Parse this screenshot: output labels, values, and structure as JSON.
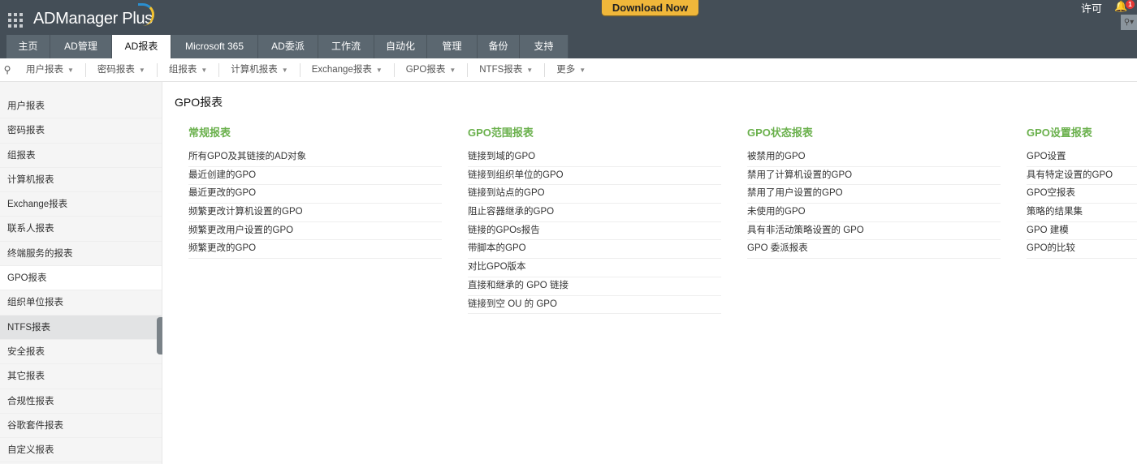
{
  "header": {
    "app_name": "ADManager Plus",
    "download_label": "Download Now",
    "license_label": "许可",
    "notification_count": "1",
    "search_icon": "search-dropdown-icon"
  },
  "tabs": [
    {
      "label": "主页"
    },
    {
      "label": "AD管理"
    },
    {
      "label": "AD报表",
      "active": true
    },
    {
      "label": "Microsoft 365"
    },
    {
      "label": "AD委派"
    },
    {
      "label": "工作流"
    },
    {
      "label": "自动化"
    },
    {
      "label": "管理"
    },
    {
      "label": "备份"
    },
    {
      "label": "支持"
    }
  ],
  "subnav": [
    "用户报表",
    "密码报表",
    "组报表",
    "计算机报表",
    "Exchange报表",
    "GPO报表",
    "NTFS报表",
    "更多"
  ],
  "sidebar": [
    "用户报表",
    "密码报表",
    "组报表",
    "计算机报表",
    "Exchange报表",
    "联系人报表",
    "终端服务的报表",
    "GPO报表",
    "组织单位报表",
    "NTFS报表",
    "安全报表",
    "其它报表",
    "合规性报表",
    "谷歌套件报表",
    "自定义报表"
  ],
  "page_title": "GPO报表",
  "columns": [
    {
      "title": "常规报表",
      "items": [
        "所有GPO及其链接的AD对象",
        "最近创建的GPO",
        "最近更改的GPO",
        "频繁更改计算机设置的GPO",
        "频繁更改用户设置的GPO",
        "频繁更改的GPO"
      ]
    },
    {
      "title": "GPO范围报表",
      "items": [
        "链接到域的GPO",
        "链接到组织单位的GPO",
        "链接到站点的GPO",
        "阻止容器继承的GPO",
        "链接的GPOs报告",
        "带脚本的GPO",
        "对比GPO版本",
        "直接和继承的 GPO 链接",
        "链接到空 OU 的 GPO"
      ]
    },
    {
      "title": "GPO状态报表",
      "items": [
        "被禁用的GPO",
        "禁用了计算机设置的GPO",
        "禁用了用户设置的GPO",
        "未使用的GPO",
        "具有非活动策略设置的 GPO",
        "GPO 委派报表"
      ]
    },
    {
      "title": "GPO设置报表",
      "items": [
        "GPO设置",
        "具有特定设置的GPO",
        "GPO空报表",
        "策略的结果集",
        "GPO 建模",
        "GPO的比较"
      ]
    }
  ]
}
